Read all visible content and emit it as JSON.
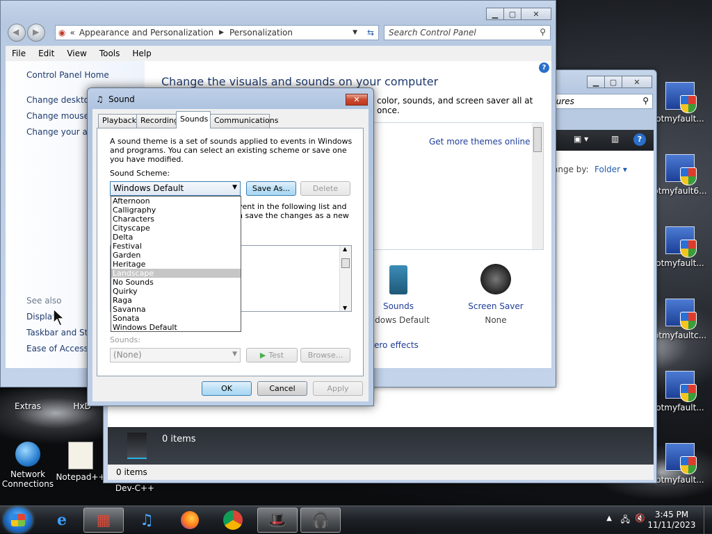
{
  "desktop": {
    "icons_left": [
      {
        "label": "Extras"
      },
      {
        "label": "HxD"
      },
      {
        "label": "Network Connections"
      },
      {
        "label": "Notepad++"
      },
      {
        "label": "Dev-C++"
      }
    ],
    "icons_right": [
      {
        "label": "otmyfault..."
      },
      {
        "label": "otmyfault6..."
      },
      {
        "label": "otmyfault..."
      },
      {
        "label": "otmyfaultc..."
      },
      {
        "label": "otmyfault..."
      },
      {
        "label": "otmyfault..."
      }
    ]
  },
  "taskbar": {
    "time": "3:45 PM",
    "date": "11/11/2023"
  },
  "control_panel": {
    "breadcrumb_root": "Appearance and Personalization",
    "breadcrumb_current": "Personalization",
    "search_placeholder": "Search Control Panel",
    "menu": [
      "File",
      "Edit",
      "View",
      "Tools",
      "Help"
    ],
    "left_links": {
      "home": "Control Panel Home",
      "desktop": "Change desktop",
      "mouse": "Change mouse p",
      "account": "Change your acc"
    },
    "see_also": "See also",
    "see_also_links": [
      "Display",
      "Taskbar and Star",
      "Ease of Access C"
    ],
    "heading": "Change the visuals and sounds on your computer",
    "subheading": "color, sounds, and screen saver all at once.",
    "themes_link": "Get more themes online",
    "sounds_label": "Sounds",
    "sounds_value": "indows Default",
    "screensaver_label": "Screen Saver",
    "screensaver_value": "None",
    "aero_link": "ero effects"
  },
  "explorer_window": {
    "search_fragment": "tures",
    "arrange_label": "ange by:",
    "arrange_value": "Folder",
    "items_count": "0 items",
    "status_items": "0 items"
  },
  "sound_dialog": {
    "title": "Sound",
    "tabs": [
      "Playback",
      "Recording",
      "Sounds",
      "Communications"
    ],
    "active_tab": "Sounds",
    "description": "A sound theme is a set of sounds applied to events in Windows and programs.  You can select an existing scheme or save one you have modified.",
    "scheme_label": "Sound Scheme:",
    "scheme_value": "Windows Default",
    "save_as_label": "Save As...",
    "delete_label": "Delete",
    "partial_text_1": "vent in the following list and",
    "partial_text_2": "n save the changes as a new",
    "scheme_options": [
      "Afternoon",
      "Calligraphy",
      "Characters",
      "Cityscape",
      "Delta",
      "Festival",
      "Garden",
      "Heritage",
      "Landscape",
      "No Sounds",
      "Quirky",
      "Raga",
      "Savanna",
      "Sonata",
      "Windows Default"
    ],
    "highlighted_option": "Landscape",
    "sounds_label": "Sounds:",
    "sounds_value": "(None)",
    "test_label": "Test",
    "browse_label": "Browse...",
    "ok_label": "OK",
    "cancel_label": "Cancel",
    "apply_label": "Apply"
  }
}
